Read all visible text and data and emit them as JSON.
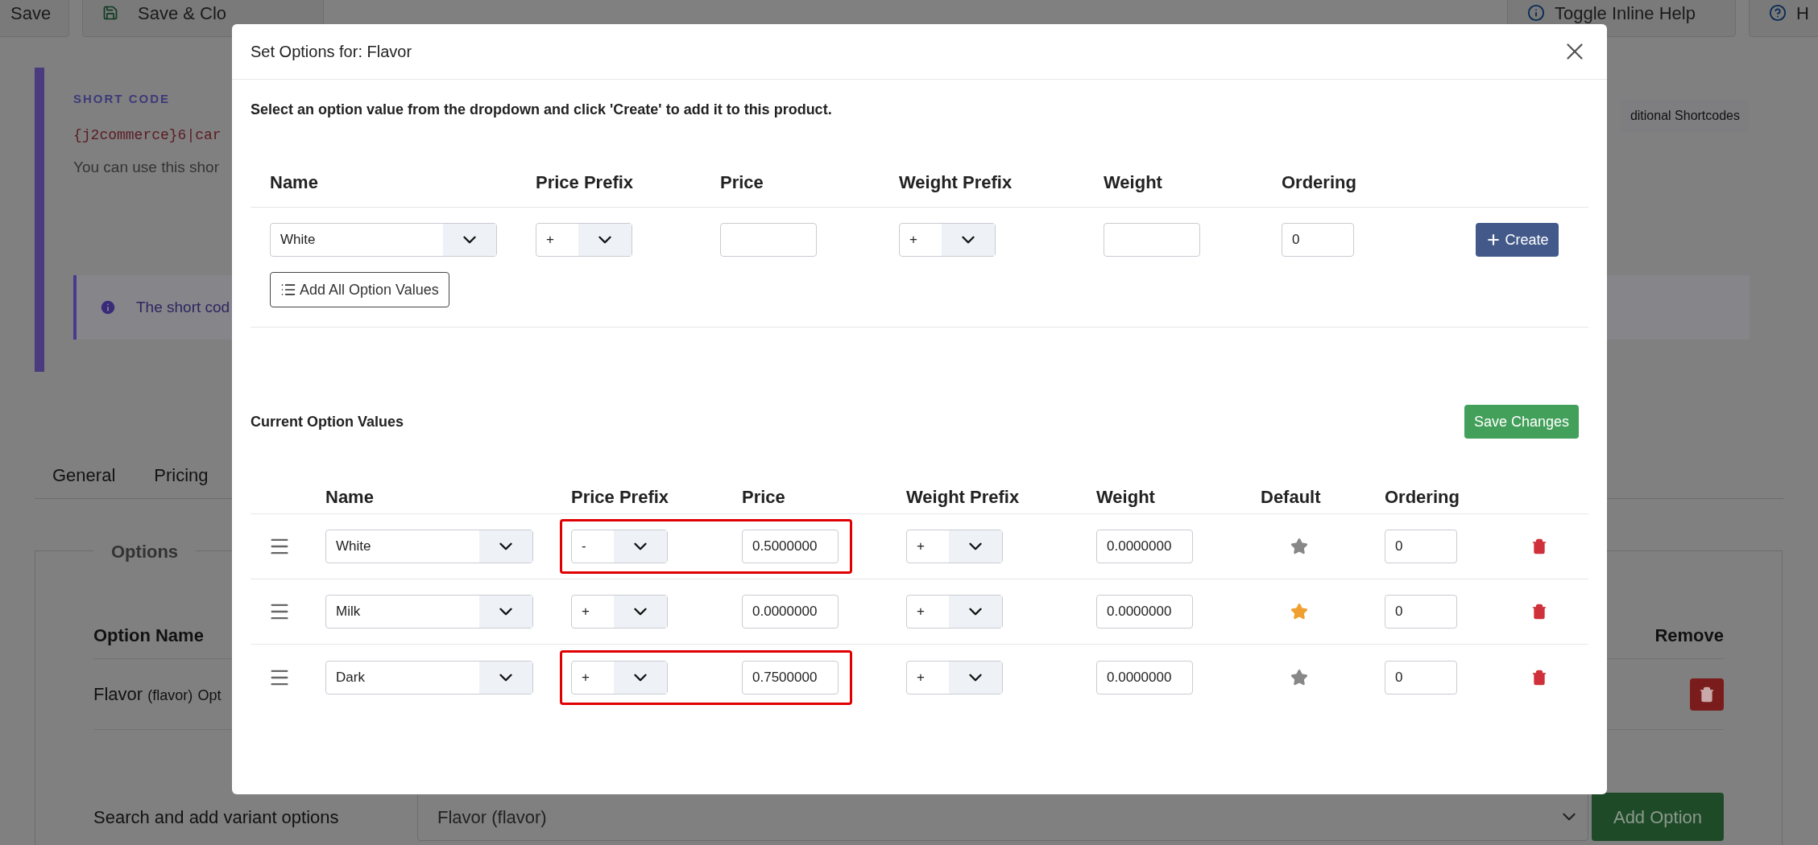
{
  "toolbar": {
    "left_buttons": [
      {
        "label": "Save",
        "kind": "plain"
      },
      {
        "label": "Save & Clo",
        "kind": "save"
      }
    ],
    "right_buttons": [
      {
        "label": "Toggle Inline Help",
        "kind": "info"
      },
      {
        "label": "H",
        "kind": "help"
      }
    ]
  },
  "shortcode": {
    "heading": "SHORT CODE",
    "code": "{j2commerce}6|car",
    "description": "You can use this shor",
    "button": "ditional Shortcodes",
    "alert": "The short cod"
  },
  "tabs": [
    "General",
    "Pricing"
  ],
  "options_panel": {
    "legend": "Options",
    "columns": [
      "Option Name",
      "Remove"
    ],
    "rows": [
      {
        "name": "Flavor",
        "code": "(flavor)",
        "extra": "Opt"
      }
    ],
    "search_label": "Search and add variant options",
    "search_value": "Flavor (flavor)",
    "add_button": "Add Option"
  },
  "modal": {
    "title": "Set Options for: Flavor",
    "instruction": "Select an option value from the dropdown and click 'Create' to add it to this product.",
    "new_value": {
      "columns": [
        "Name",
        "Price Prefix",
        "Price",
        "Weight Prefix",
        "Weight",
        "Ordering"
      ],
      "name": "White",
      "price_prefix": "+",
      "weight_prefix": "+",
      "ordering": "0",
      "create_button": "Create",
      "add_all_button": "Add All Option Values"
    },
    "current": {
      "title": "Current Option Values",
      "save_button": "Save Changes",
      "columns": [
        "Name",
        "Price Prefix",
        "Price",
        "Weight Prefix",
        "Weight",
        "Default",
        "Ordering"
      ],
      "rows": [
        {
          "name": "White",
          "price_prefix": "-",
          "price": "0.5000000",
          "weight_prefix": "+",
          "weight": "0.0000000",
          "default": false,
          "ordering": "0",
          "highlighted": true
        },
        {
          "name": "Milk",
          "price_prefix": "+",
          "price": "0.0000000",
          "weight_prefix": "+",
          "weight": "0.0000000",
          "default": true,
          "ordering": "0",
          "highlighted": false
        },
        {
          "name": "Dark",
          "price_prefix": "+",
          "price": "0.7500000",
          "weight_prefix": "+",
          "weight": "0.0000000",
          "default": false,
          "ordering": "0",
          "highlighted": true
        }
      ]
    }
  }
}
